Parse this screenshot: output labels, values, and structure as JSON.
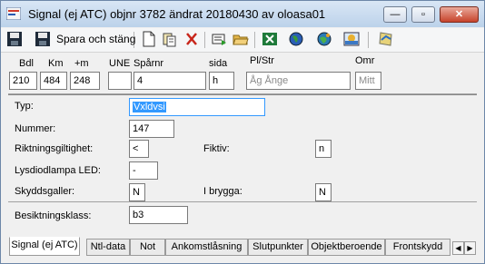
{
  "window": {
    "title": "Signal (ej ATC)  objnr 3782 ändrat 20180430 av oloasa01",
    "buttons": {
      "minimize": "—",
      "maximize": "▫",
      "close": "✕"
    }
  },
  "toolbar": {
    "save_close_label": "Spara och stäng",
    "icons": [
      "save-icon",
      "save-close-icon",
      "new-icon",
      "copy-icon",
      "delete-icon",
      "report-icon",
      "open-folder-icon",
      "excel-icon",
      "globe-icon",
      "globe-alt-icon",
      "map-icon",
      "update-icon"
    ]
  },
  "header": {
    "labels": {
      "bdl": "Bdl",
      "km": "Km",
      "plus_m": "+m",
      "une": "UNE",
      "spar": "Spårnr",
      "sida": "sida",
      "pl_str": "Pl/Str",
      "omr": "Omr"
    },
    "values": {
      "bdl": "210",
      "km": "484",
      "plus_m": "248",
      "une": "",
      "spar": "4",
      "sida": "h"
    },
    "placeholders": {
      "pl_str": "Åg Ånge",
      "omr": "Mitt"
    }
  },
  "form": {
    "typ": {
      "label": "Typ:",
      "value": "Vxldvsi"
    },
    "nummer": {
      "label": "Nummer:",
      "value": "147"
    },
    "riktning": {
      "label": "Riktningsgiltighet:",
      "value": "<"
    },
    "fiktiv": {
      "label": "Fiktiv:",
      "value": "n"
    },
    "lysdiod": {
      "label": "Lysdiodlampa LED:",
      "value": "-"
    },
    "skydd": {
      "label": "Skyddsgaller:",
      "value": "N"
    },
    "brygga": {
      "label": "I brygga:",
      "value": "N"
    },
    "besiktning": {
      "label": "Besiktningsklass:",
      "value": "b3"
    }
  },
  "tabs": [
    "Signal (ej ATC)",
    "Ntl-data",
    "Not",
    "Ankomstlåsning",
    "Slutpunkter",
    "Objektberoende",
    "Frontskydd"
  ],
  "tab_arrows": {
    "left": "◀",
    "right": "▶"
  },
  "colors": {
    "title_bar": "#bcd2ea",
    "selection": "#3399ff",
    "close_button": "#c7432b"
  }
}
